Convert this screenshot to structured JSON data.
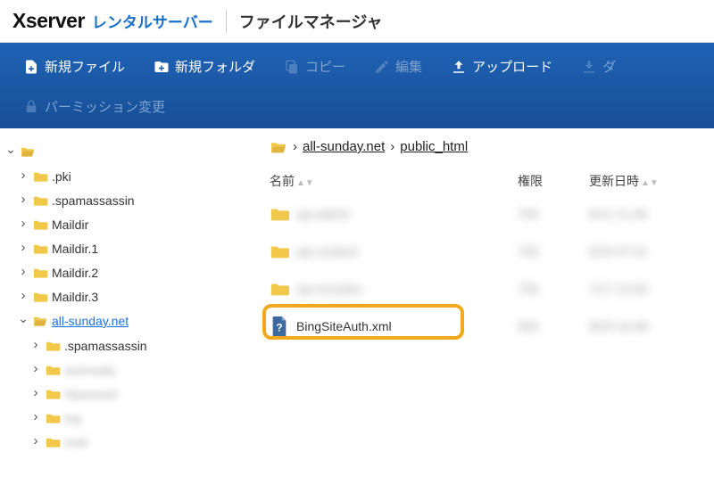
{
  "header": {
    "brand_main": "Xserver",
    "brand_sub": "レンタルサーバー",
    "app_name": "ファイルマネージャ"
  },
  "toolbar": {
    "new_file": "新規ファイル",
    "new_folder": "新規フォルダ",
    "copy": "コピー",
    "edit": "編集",
    "upload": "アップロード",
    "download": "ダ",
    "permission": "パーミッション変更"
  },
  "sidebar": {
    "items": [
      {
        "label": ".pki"
      },
      {
        "label": ".spamassassin"
      },
      {
        "label": "Maildir"
      },
      {
        "label": "Maildir.1"
      },
      {
        "label": "Maildir.2"
      },
      {
        "label": "Maildir.3"
      },
      {
        "label": "all-sunday.net"
      },
      {
        "label": ".spamassassin"
      },
      {
        "label": "autoreply"
      },
      {
        "label": "htpasswd"
      },
      {
        "label": "log"
      },
      {
        "label": "mail"
      }
    ]
  },
  "breadcrumb": {
    "p1": "all-sunday.net",
    "p2": "public_html"
  },
  "table": {
    "head_name": "名前",
    "head_perm": "権限",
    "head_date": "更新日時",
    "rows": [
      {
        "type": "folder",
        "name": "wp-admin",
        "perm": "755",
        "date": "6/12 11:36"
      },
      {
        "type": "folder",
        "name": "wp-content",
        "perm": "755",
        "date": "8/29 07:01"
      },
      {
        "type": "folder",
        "name": "wp-includes",
        "perm": "755",
        "date": "7/17 10:50"
      },
      {
        "type": "file",
        "name": "BingSiteAuth.xml",
        "perm": "604",
        "date": "8/29 16:38",
        "highlighted": true
      }
    ]
  }
}
